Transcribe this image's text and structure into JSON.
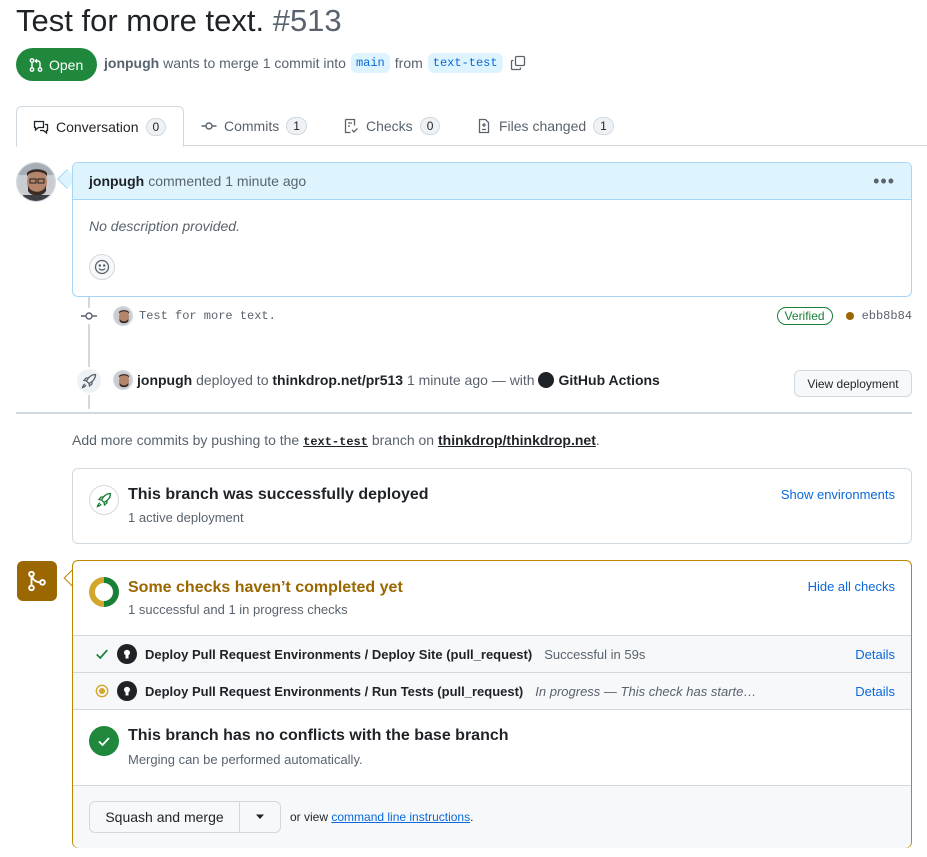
{
  "pr": {
    "title": "Test for more text.",
    "number": "#513",
    "state": "Open",
    "author": "jonpugh",
    "merge_text": "wants to merge 1 commit into",
    "base_branch": "main",
    "from_text": "from",
    "head_branch": "text-test"
  },
  "tabs": [
    {
      "label": "Conversation",
      "count": "0",
      "icon": "comment-discussion-icon"
    },
    {
      "label": "Commits",
      "count": "1",
      "icon": "git-commit-icon"
    },
    {
      "label": "Checks",
      "count": "0",
      "icon": "checklist-icon"
    },
    {
      "label": "Files changed",
      "count": "1",
      "icon": "file-diff-icon"
    }
  ],
  "comment": {
    "author": "jonpugh",
    "action": "commented 1 minute ago",
    "body": "No description provided."
  },
  "commit": {
    "message": "Test for more text.",
    "verified": "Verified",
    "sha": "ebb8b84"
  },
  "deployment": {
    "user": "jonpugh",
    "text1": "deployed to",
    "env": "thinkdrop.net/pr513",
    "text2": "1 minute ago — with",
    "app": "GitHub Actions",
    "button": "View deployment"
  },
  "push_note": {
    "prefix": "Add more commits by pushing to the",
    "branch": "text-test",
    "middle": "branch on",
    "repo": "thinkdrop/thinkdrop.net",
    "suffix": "."
  },
  "deploy_box": {
    "title": "This branch was successfully deployed",
    "subtitle": "1 active deployment",
    "link": "Show environments"
  },
  "checks": {
    "title": "Some checks haven’t completed yet",
    "subtitle": "1 successful and 1 in progress checks",
    "toggle": "Hide all checks",
    "items": [
      {
        "name": "Deploy Pull Request Environments / Deploy Site (pull_request)",
        "status": "Successful in 59s",
        "details": "Details",
        "state": "success"
      },
      {
        "name": "Deploy Pull Request Environments / Run Tests (pull_request)",
        "status": "In progress — This check has starte…",
        "details": "Details",
        "state": "in_progress"
      }
    ]
  },
  "conflicts": {
    "title": "This branch has no conflicts with the base branch",
    "subtitle": "Merging can be performed automatically."
  },
  "merge": {
    "button": "Squash and merge",
    "or_text": "or view",
    "cli_link": "command line instructions",
    "suffix": "."
  },
  "colors": {
    "open_green": "#1f883d",
    "accent_blue": "#0969da",
    "pending_yellow": "#9a6700",
    "comment_header": "#ddf4ff"
  }
}
